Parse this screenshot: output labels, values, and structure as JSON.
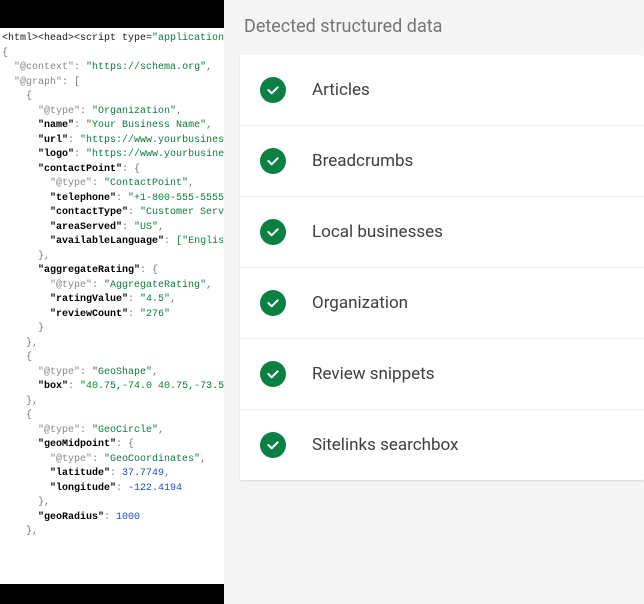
{
  "section_title": "Detected structured data",
  "items": [
    {
      "label": "Articles"
    },
    {
      "label": "Breadcrumbs"
    },
    {
      "label": "Local businesses"
    },
    {
      "label": "Organization"
    },
    {
      "label": "Review snippets"
    },
    {
      "label": "Sitelinks searchbox"
    }
  ],
  "code": {
    "opening_tag": "<html><head><script type=",
    "opening_tag_val": "\"application",
    "context_key": "\"@context\"",
    "context_val": "\"https://schema.org\"",
    "graph_key": "\"@graph\"",
    "org_type_key": "\"@type\"",
    "org_type_val": "\"Organization\"",
    "name_key": "\"name\"",
    "name_val": "\"Your Business Name\"",
    "url_key": "\"url\"",
    "url_val": "\"https://www.yourbusines",
    "logo_key": "\"logo\"",
    "logo_val": "\"https://www.yourbusine",
    "contactPoint_key": "\"contactPoint\"",
    "cp_type_key": "\"@type\"",
    "cp_type_val": "\"ContactPoint\"",
    "telephone_key": "\"telephone\"",
    "telephone_val": "\"+1-800-555-5555",
    "contactType_key": "\"contactType\"",
    "contactType_val": "\"Customer Serv",
    "areaServed_key": "\"areaServed\"",
    "areaServed_val": "\"US\"",
    "availableLanguage_key": "\"availableLanguage\"",
    "availableLanguage_val": "[\"Englis",
    "aggregateRating_key": "\"aggregateRating\"",
    "ar_type_key": "\"@type\"",
    "ar_type_val": "\"AggregateRating\"",
    "ratingValue_key": "\"ratingValue\"",
    "ratingValue_val": "\"4.5\"",
    "reviewCount_key": "\"reviewCount\"",
    "reviewCount_val": "\"276\"",
    "geoshape_type_key": "\"@type\"",
    "geoshape_type_val": "\"GeoShape\"",
    "box_key": "\"box\"",
    "box_val": "\"40.75,-74.0 40.75,-73.5",
    "geocircle_type_key": "\"@type\"",
    "geocircle_type_val": "\"GeoCircle\"",
    "geoMidpoint_key": "\"geoMidpoint\"",
    "gm_type_key": "\"@type\"",
    "gm_type_val": "\"GeoCoordinates\"",
    "latitude_key": "\"latitude\"",
    "latitude_val": "37.7749",
    "longitude_key": "\"longitude\"",
    "longitude_val": "-122.4194",
    "geoRadius_key": "\"geoRadius\"",
    "geoRadius_val": "1000"
  }
}
